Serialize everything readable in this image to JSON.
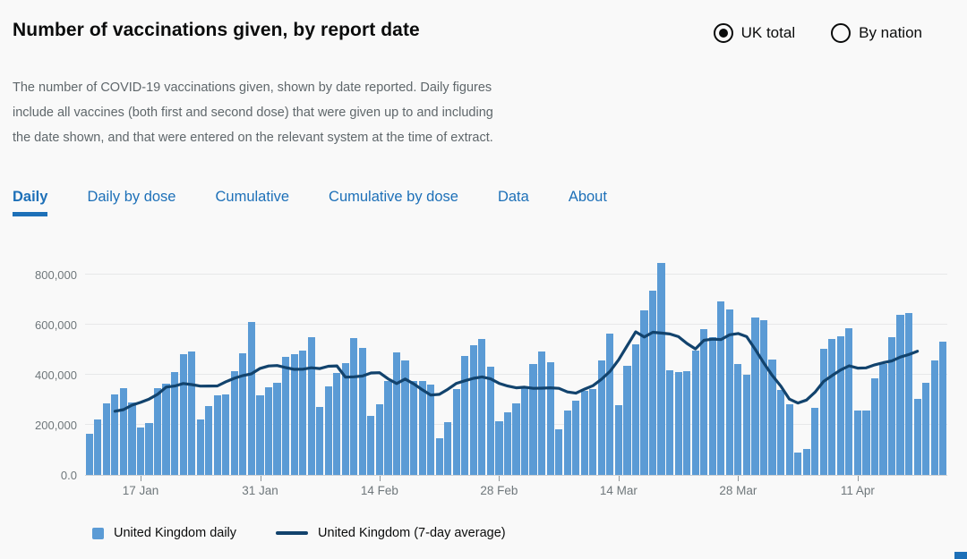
{
  "header": {
    "title": "Number of vaccinations given, by report date",
    "view_toggle": {
      "options": [
        {
          "label": "UK total",
          "selected": true
        },
        {
          "label": "By nation",
          "selected": false
        }
      ]
    }
  },
  "description": "The number of COVID-19 vaccinations given, shown by date reported. Daily figures include all vaccines (both first and second dose) that were given up to and including the date shown, and that were entered on the relevant system at the time of extract.",
  "tabs": [
    {
      "label": "Daily",
      "active": true
    },
    {
      "label": "Daily by dose",
      "active": false
    },
    {
      "label": "Cumulative",
      "active": false
    },
    {
      "label": "Cumulative by dose",
      "active": false
    },
    {
      "label": "Data",
      "active": false
    },
    {
      "label": "About",
      "active": false
    }
  ],
  "chart_data": {
    "type": "bar",
    "title": "Number of vaccinations given, by report date",
    "x_start_date": "11 Jan 2021",
    "x_end_date": "21 Apr 2021",
    "x_tick_labels": [
      "17 Jan",
      "31 Jan",
      "14 Feb",
      "28 Feb",
      "14 Mar",
      "28 Mar",
      "11 Apr"
    ],
    "x_tick_day_indices": [
      6,
      20,
      34,
      48,
      62,
      76,
      90
    ],
    "y_tick_labels": [
      "0.0",
      "200,000",
      "400,000",
      "600,000",
      "800,000"
    ],
    "y_tick_values": [
      0,
      200000,
      400000,
      600000,
      800000
    ],
    "ylim": [
      0,
      875000
    ],
    "grid": true,
    "legend_position": "bottom",
    "series": [
      {
        "name": "United Kingdom daily",
        "type": "bar",
        "color": "#5b9bd5",
        "values": [
          161000,
          220000,
          284000,
          319000,
          345000,
          289000,
          188000,
          205000,
          344000,
          363000,
          410000,
          479000,
          492000,
          218000,
          274000,
          315000,
          319000,
          412000,
          483000,
          608000,
          317000,
          348000,
          365000,
          469000,
          481000,
          495000,
          550000,
          270000,
          351000,
          404000,
          446000,
          546000,
          505000,
          235000,
          280000,
          375000,
          487000,
          455000,
          374000,
          374000,
          360000,
          146000,
          208000,
          341000,
          475000,
          515000,
          540000,
          432000,
          213000,
          250000,
          285000,
          350000,
          440000,
          490000,
          450000,
          180000,
          255000,
          295000,
          335000,
          341000,
          455000,
          562000,
          277000,
          434000,
          519000,
          655000,
          735000,
          844000,
          416000,
          410000,
          412000,
          493000,
          579000,
          547000,
          690000,
          660000,
          440000,
          400000,
          626000,
          615000,
          458000,
          336000,
          281000,
          88000,
          101000,
          267000,
          503000,
          541000,
          553000,
          583000,
          255000,
          255000,
          384000,
          440000,
          547000,
          638000,
          644000,
          303000,
          365000,
          454000,
          531000
        ]
      },
      {
        "name": "United Kingdom (7-day average)",
        "type": "line",
        "color": "#12436d",
        "derivation": "centered 7-day rolling mean of the daily values"
      }
    ]
  },
  "legend": {
    "bar_label": "United Kingdom daily",
    "line_label": "United Kingdom (7-day average)"
  },
  "colors": {
    "background": "#f9f9f9",
    "accent_blue": "#1d70b8",
    "bar_blue": "#5b9bd5",
    "line_navy": "#12436d",
    "text_dark": "#0b0c0c",
    "text_gray": "#5f676b",
    "axis_gray": "#6f777b"
  }
}
